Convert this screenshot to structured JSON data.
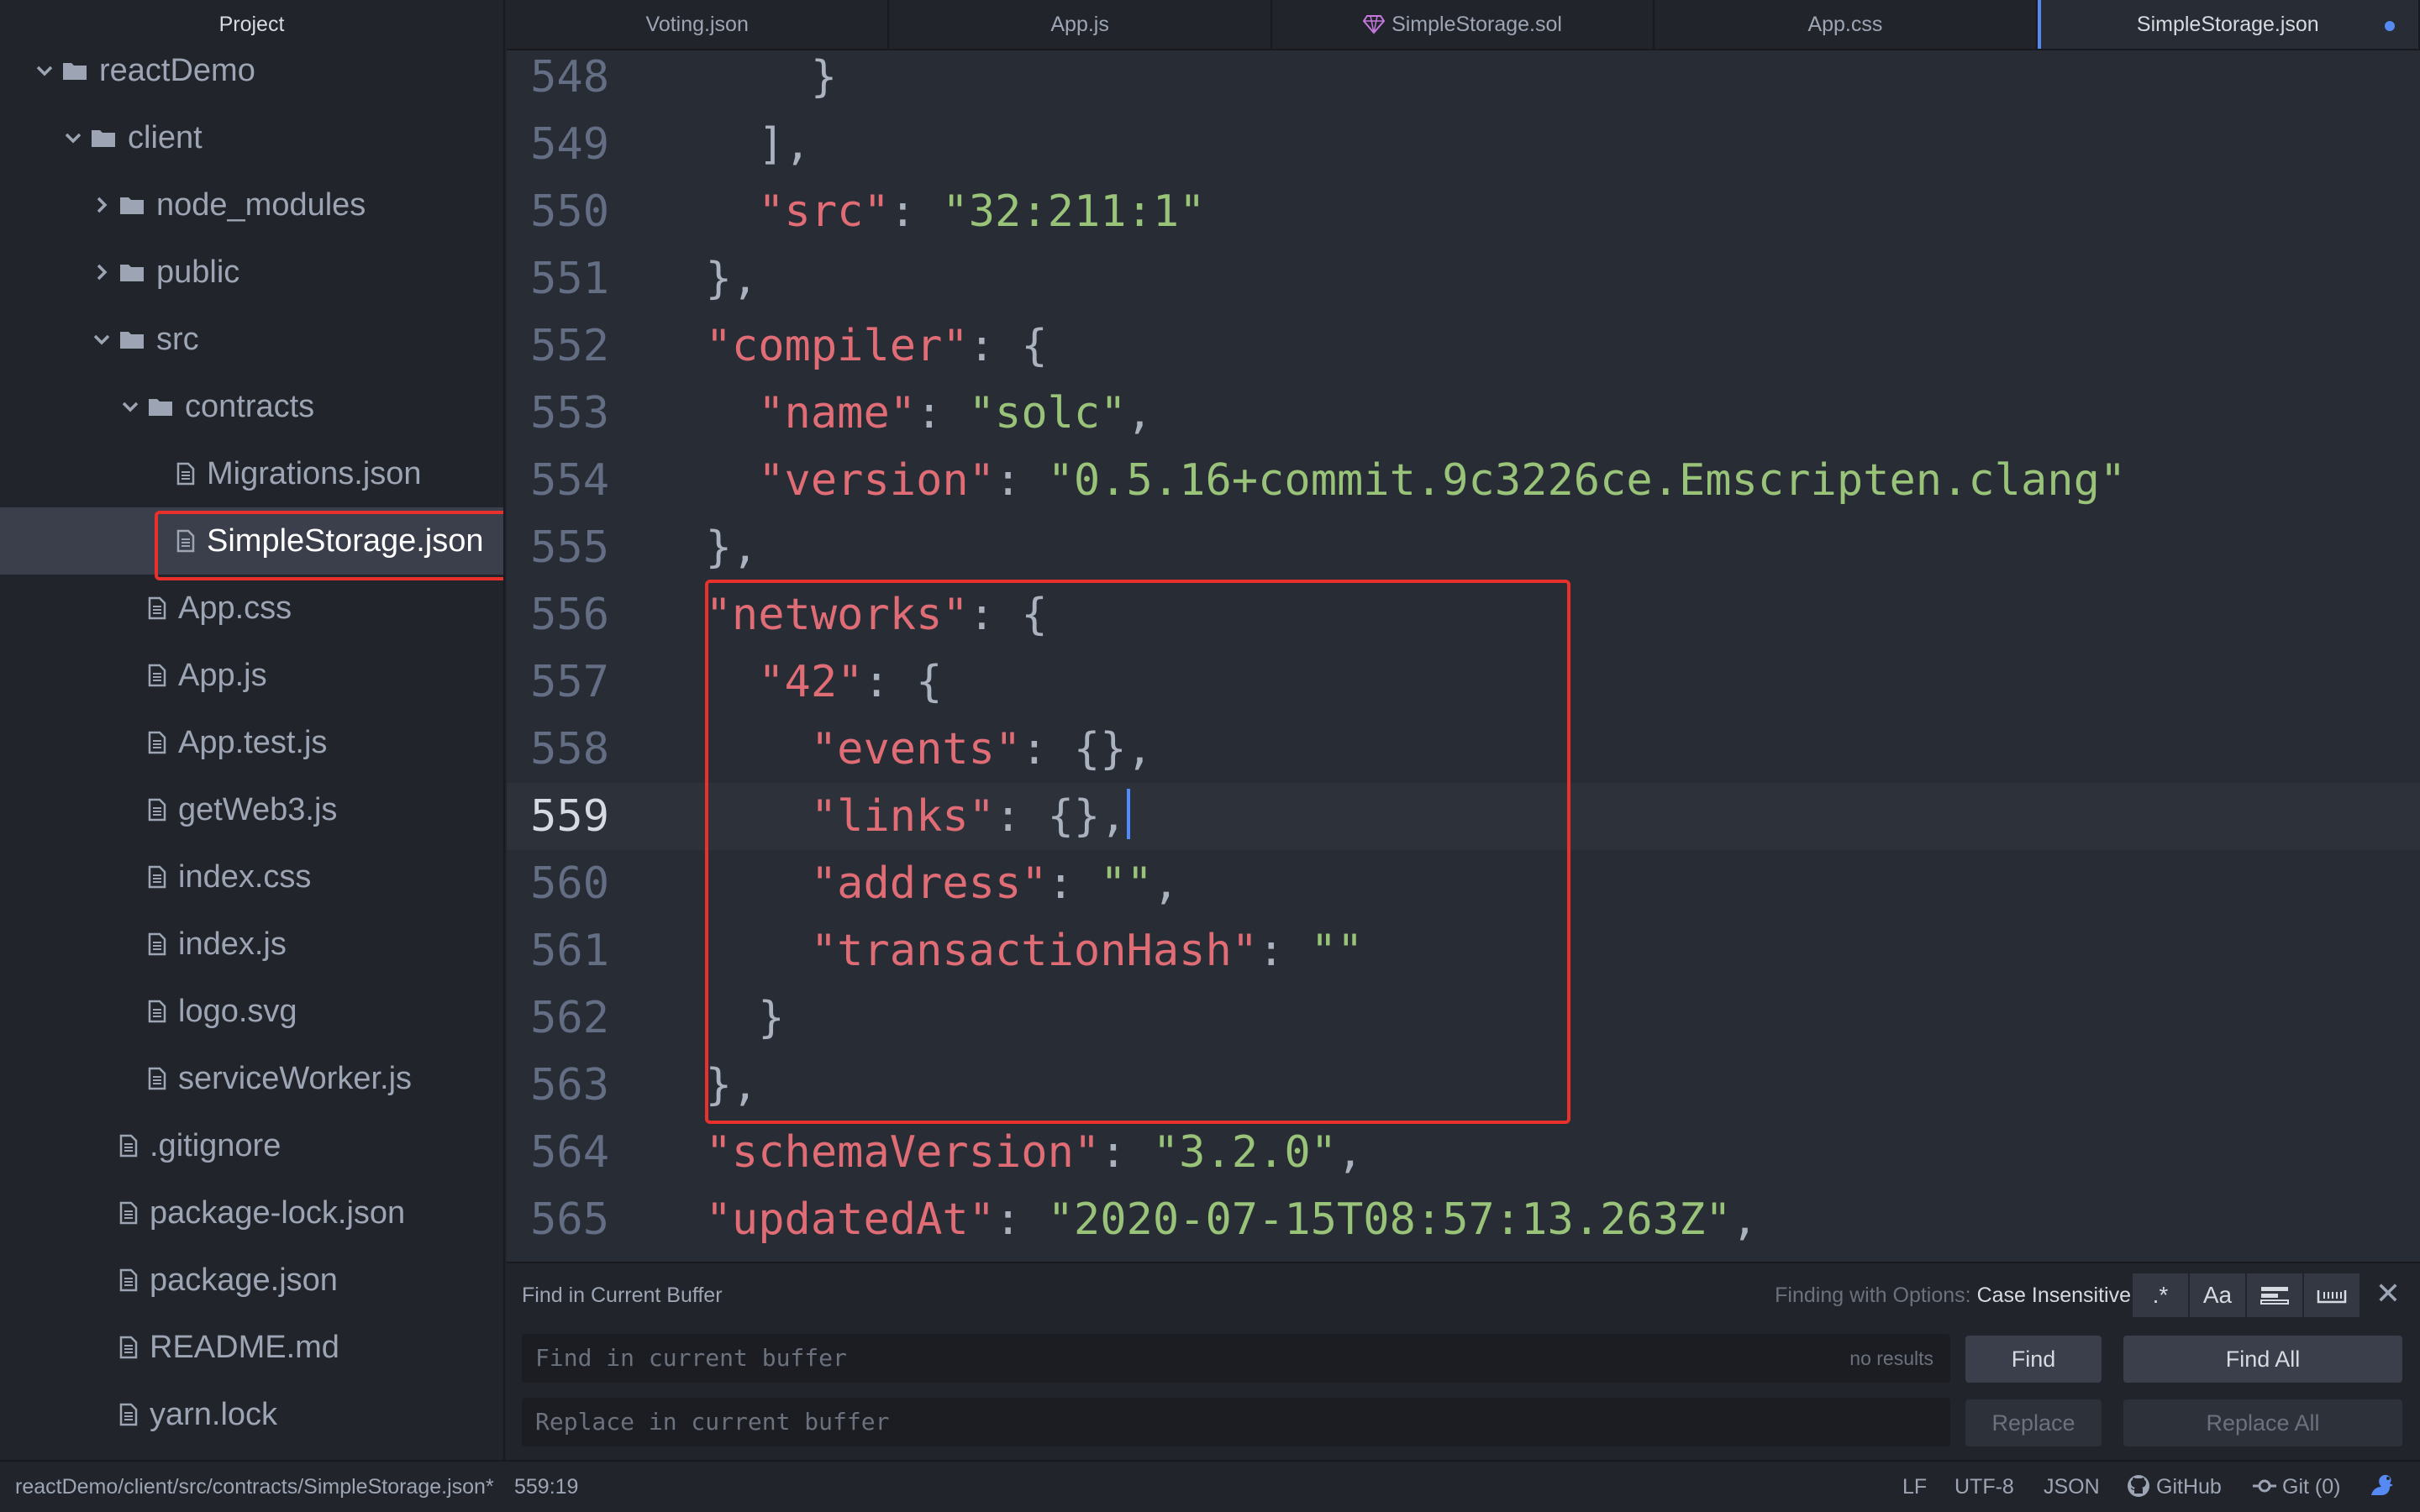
{
  "sidebar": {
    "title": "Project",
    "tree": [
      {
        "label": "reactDemo",
        "type": "folder",
        "expanded": true
      },
      {
        "label": "client",
        "type": "folder",
        "expanded": true
      },
      {
        "label": "node_modules",
        "type": "folder",
        "expanded": false
      },
      {
        "label": "public",
        "type": "folder",
        "expanded": false
      },
      {
        "label": "src",
        "type": "folder",
        "expanded": true
      },
      {
        "label": "contracts",
        "type": "folder",
        "expanded": true
      },
      {
        "label": "Migrations.json",
        "type": "file"
      },
      {
        "label": "SimpleStorage.json",
        "type": "file",
        "selected": true
      },
      {
        "label": "App.css",
        "type": "file"
      },
      {
        "label": "App.js",
        "type": "file"
      },
      {
        "label": "App.test.js",
        "type": "file"
      },
      {
        "label": "getWeb3.js",
        "type": "file"
      },
      {
        "label": "index.css",
        "type": "file"
      },
      {
        "label": "index.js",
        "type": "file"
      },
      {
        "label": "logo.svg",
        "type": "file"
      },
      {
        "label": "serviceWorker.js",
        "type": "file"
      },
      {
        "label": ".gitignore",
        "type": "file"
      },
      {
        "label": "package-lock.json",
        "type": "file"
      },
      {
        "label": "package.json",
        "type": "file"
      },
      {
        "label": "README.md",
        "type": "file"
      },
      {
        "label": "yarn.lock",
        "type": "file"
      }
    ]
  },
  "tabs": [
    {
      "label": "Voting.json"
    },
    {
      "label": "App.js"
    },
    {
      "label": "SimpleStorage.sol"
    },
    {
      "label": "App.css"
    },
    {
      "label": "SimpleStorage.json",
      "active": true,
      "modified": true
    }
  ],
  "editor": {
    "cursor_line": "559",
    "lines": [
      {
        "n": "548",
        "text": "      }"
      },
      {
        "n": "549",
        "text": "    ],"
      },
      {
        "n": "550",
        "text": "    \"src\": \"32:211:1\""
      },
      {
        "n": "551",
        "text": "  },"
      },
      {
        "n": "552",
        "text": "  \"compiler\": {"
      },
      {
        "n": "553",
        "text": "    \"name\": \"solc\","
      },
      {
        "n": "554",
        "text": "    \"version\": \"0.5.16+commit.9c3226ce.Emscripten.clang\""
      },
      {
        "n": "555",
        "text": "  },"
      },
      {
        "n": "556",
        "text": "  \"networks\": {"
      },
      {
        "n": "557",
        "text": "    \"42\": {"
      },
      {
        "n": "558",
        "text": "      \"events\": {},"
      },
      {
        "n": "559",
        "text": "      \"links\": {},"
      },
      {
        "n": "560",
        "text": "      \"address\": \"\","
      },
      {
        "n": "561",
        "text": "      \"transactionHash\": \"\""
      },
      {
        "n": "562",
        "text": "    }"
      },
      {
        "n": "563",
        "text": "  },"
      },
      {
        "n": "564",
        "text": "  \"schemaVersion\": \"3.2.0\","
      },
      {
        "n": "565",
        "text": "  \"updatedAt\": \"2020-07-15T08:57:13.263Z\","
      }
    ]
  },
  "find": {
    "title": "Find in Current Buffer",
    "options_prefix": "Finding with Options:",
    "options_value": "Case Insensitive",
    "option_buttons": [
      ".*",
      "Aa",
      "selection-icon",
      "whole-word-icon"
    ],
    "find_placeholder": "Find in current buffer",
    "replace_placeholder": "Replace in current buffer",
    "result_text": "no results",
    "find_label": "Find",
    "find_all_label": "Find All",
    "replace_label": "Replace",
    "replace_all_label": "Replace All"
  },
  "status": {
    "path": "reactDemo/client/src/contracts/SimpleStorage.json*",
    "position": "559:19",
    "line_ending": "LF",
    "encoding": "UTF-8",
    "grammar": "JSON",
    "github": "GitHub",
    "git": "Git (0)"
  },
  "colors": {
    "accent": "#568af2",
    "highlight": "#e8302c",
    "key": "#e06c75",
    "string": "#98c379"
  }
}
